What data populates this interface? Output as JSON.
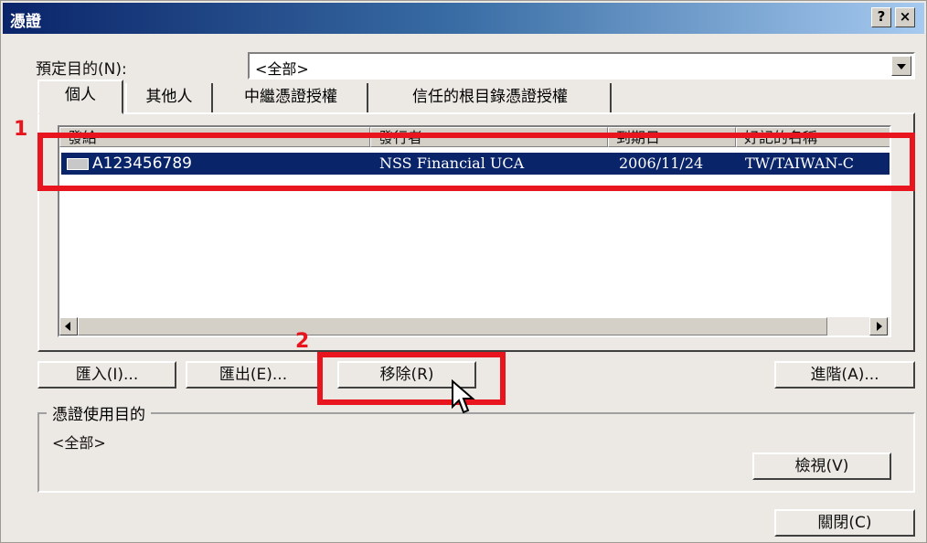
{
  "window": {
    "title": "憑證",
    "help_label": "?",
    "close_label": "×"
  },
  "purpose": {
    "label": "預定目的(N):",
    "value": "<全部>"
  },
  "tabs": [
    {
      "label": "個人"
    },
    {
      "label": "其他人"
    },
    {
      "label": "中繼憑證授權"
    },
    {
      "label": "信任的根目錄憑證授權"
    }
  ],
  "list": {
    "columns": [
      "發給",
      "發行者",
      "到期日",
      "好記的名稱"
    ],
    "rows": [
      {
        "issued_to": "A123456789",
        "issuer": "NSS Financial UCA",
        "expires": "2006/11/24",
        "friendly": "TW/TAIWAN-C"
      }
    ]
  },
  "buttons": {
    "import": "匯入(I)...",
    "export": "匯出(E)...",
    "remove": "移除(R)",
    "advanced": "進階(A)...",
    "view": "檢視(V)",
    "close": "關閉(C)"
  },
  "usage": {
    "label": "憑證使用目的",
    "value": "<全部>"
  },
  "annotations": {
    "step1": "1",
    "step2": "2",
    "color": "#e8141e"
  }
}
